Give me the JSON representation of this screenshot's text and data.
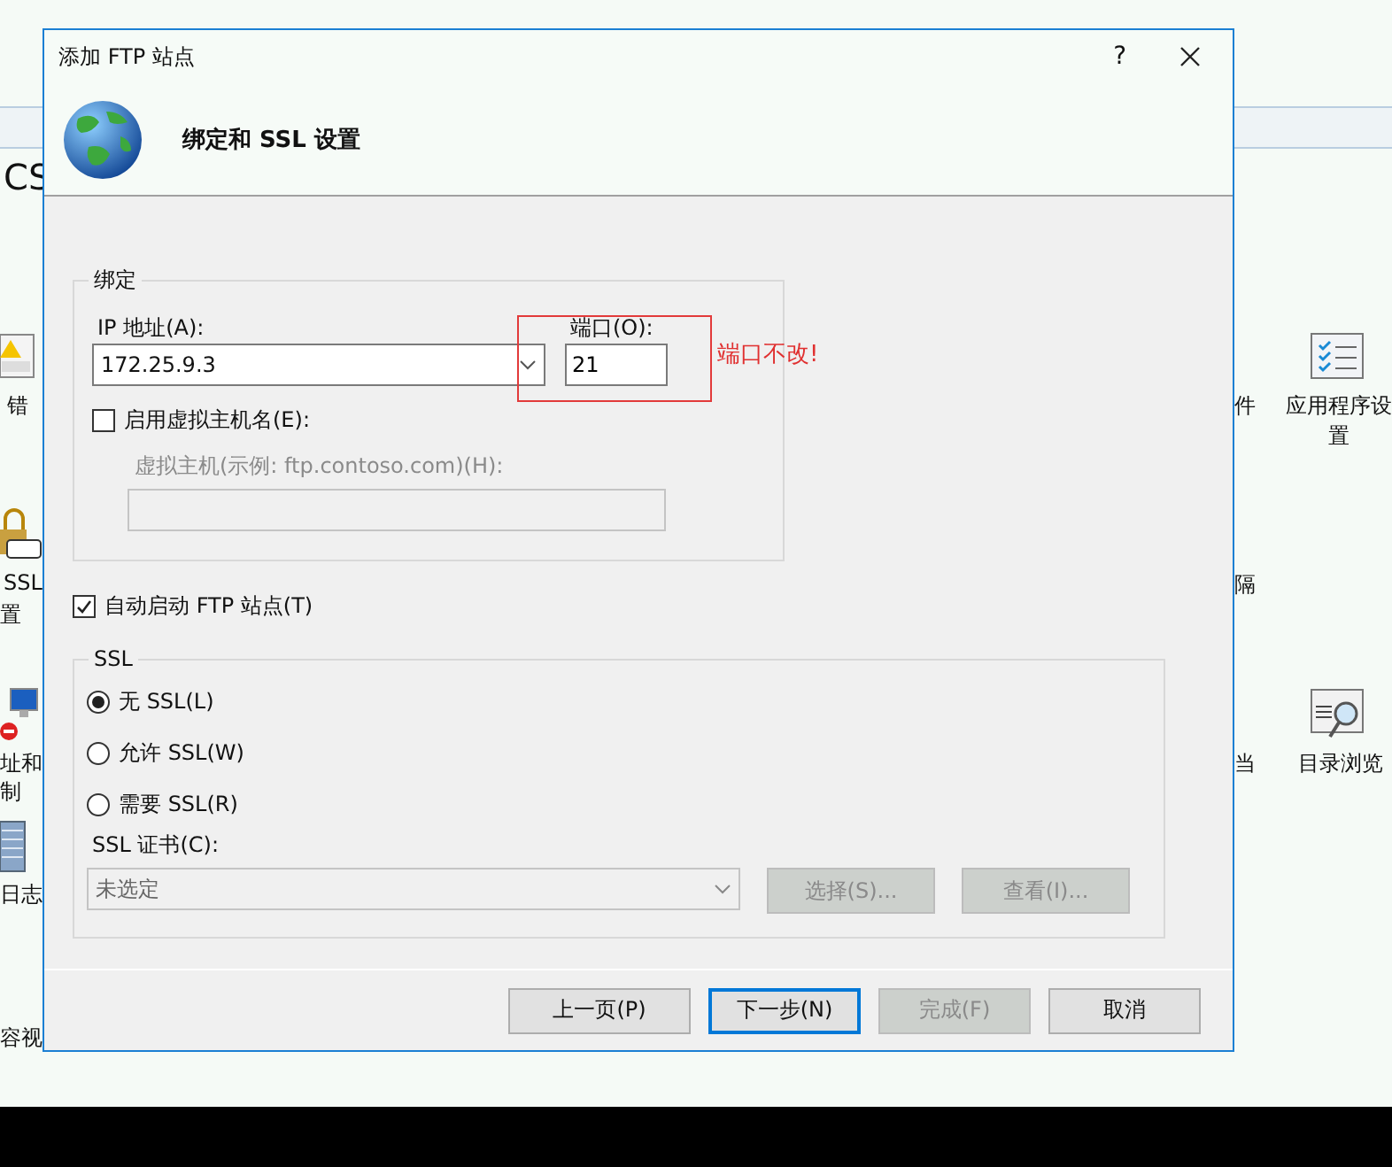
{
  "background": {
    "left_labels": [
      "CS",
      "错",
      "SSL",
      "置",
      "址和",
      "制",
      "日志",
      "容视"
    ],
    "right_labels": [
      "件",
      "应用程序设",
      "置",
      "隔",
      "当",
      "目录浏览"
    ]
  },
  "dialog": {
    "title": "添加 FTP 站点",
    "help": "?",
    "heading": "绑定和 SSL 设置",
    "binding": {
      "legend": "绑定",
      "ip_label": "IP 地址(A):",
      "ip_value": "172.25.9.3",
      "port_label": "端口(O):",
      "port_value": "21",
      "virtual_host": {
        "label": "启用虚拟主机名(E):",
        "checked": false
      },
      "host_label": "虚拟主机(示例: ftp.contoso.com)(H):",
      "host_disabled": true
    },
    "annotation": "端口不改!",
    "auto_start": {
      "label": "自动启动 FTP 站点(T)",
      "checked": true
    },
    "ssl": {
      "legend": "SSL",
      "options": [
        {
          "label": "无 SSL(L)",
          "selected": true
        },
        {
          "label": "允许 SSL(W)",
          "selected": false
        },
        {
          "label": "需要 SSL(R)",
          "selected": false
        }
      ],
      "cert_label": "SSL 证书(C):",
      "cert_value": "未选定",
      "cert_disabled": true,
      "buttons": [
        {
          "label": "选择(S)...",
          "disabled": true
        },
        {
          "label": "查看(I)...",
          "disabled": true
        }
      ]
    },
    "buttons": [
      {
        "label": "上一页(P)",
        "disabled": false,
        "default": false
      },
      {
        "label": "下一步(N)",
        "disabled": false,
        "default": true
      },
      {
        "label": "完成(F)",
        "disabled": true,
        "default": false
      },
      {
        "label": "取消",
        "disabled": false,
        "default": false
      }
    ]
  }
}
